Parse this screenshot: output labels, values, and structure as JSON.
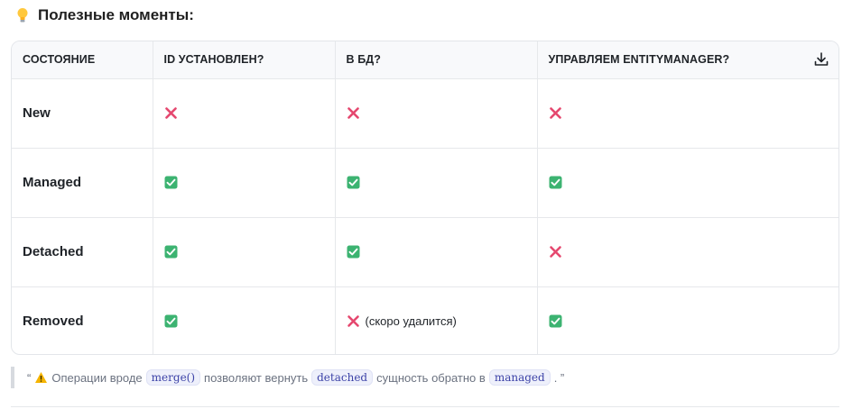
{
  "heading": {
    "title": "Полезные моменты:",
    "icon": "lightbulb-icon"
  },
  "table": {
    "headers": [
      "СОСТОЯНИЕ",
      "ID УСТАНОВЛЕН?",
      "В БД?",
      "УПРАВЛЯЕМ ENTITYMANAGER?"
    ],
    "rows": [
      {
        "state": "New",
        "id_set": "cross",
        "in_db": "cross",
        "in_db_note": "",
        "managed": "cross"
      },
      {
        "state": "Managed",
        "id_set": "check",
        "in_db": "check",
        "in_db_note": "",
        "managed": "check"
      },
      {
        "state": "Detached",
        "id_set": "check",
        "in_db": "check",
        "in_db_note": "",
        "managed": "cross"
      },
      {
        "state": "Removed",
        "id_set": "check",
        "in_db": "cross",
        "in_db_note": "(скоро удалится)",
        "managed": "check"
      }
    ],
    "download_icon": "download-icon"
  },
  "note": {
    "open_quote": "“",
    "prefix": "Операции вроде",
    "code1": "merge()",
    "middle": "позволяют вернуть",
    "code2": "detached",
    "after": "сущность обратно в",
    "code3": "managed",
    "end": ". ”",
    "icon": "warning-icon"
  },
  "colors": {
    "cross": "#e5486f",
    "check": "#3cb371",
    "code_bg": "#eef0fb",
    "code_text": "#3d43a8"
  }
}
